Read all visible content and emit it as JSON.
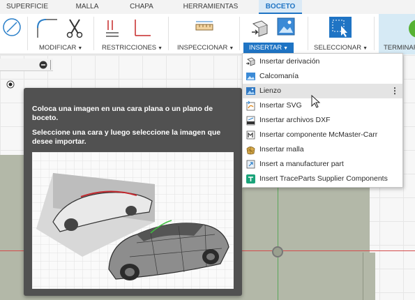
{
  "tabs": [
    {
      "label": "SUPERFICIE"
    },
    {
      "label": "MALLA"
    },
    {
      "label": "CHAPA"
    },
    {
      "label": "HERRAMIENTAS"
    },
    {
      "label": "BOCETO"
    }
  ],
  "ribbon": {
    "groups": [
      {
        "label": "MODIFICAR"
      },
      {
        "label": "RESTRICCIONES"
      },
      {
        "label": "INSPECCIONAR"
      },
      {
        "label": "INSERTAR"
      },
      {
        "label": "SELECCIONAR"
      },
      {
        "label": "TERMINAR"
      }
    ]
  },
  "insert_menu": {
    "items": [
      {
        "label": "Insertar derivación",
        "icon": "derive-icon"
      },
      {
        "label": "Calcomanía",
        "icon": "decal-icon"
      },
      {
        "label": "Lienzo",
        "icon": "canvas-icon"
      },
      {
        "label": "Insertar SVG",
        "icon": "svg-icon"
      },
      {
        "label": "Insertar archivos DXF",
        "icon": "dxf-icon"
      },
      {
        "label": "Insertar componente McMaster-Carr",
        "icon": "mcmaster-icon"
      },
      {
        "label": "Insertar malla",
        "icon": "mesh-icon"
      },
      {
        "label": "Insert a manufacturer part",
        "icon": "manufacturer-part-icon"
      },
      {
        "label": "Insert TraceParts Supplier Components",
        "icon": "traceparts-icon"
      }
    ],
    "more_glyph": "⋮"
  },
  "tooltip": {
    "line1": "Coloca una imagen en una cara plana o un plano de boceto.",
    "line2": "Seleccione una cara y luego seleccione la imagen que desee importar."
  },
  "colors": {
    "accent": "#1f74c4",
    "finish_green": "#56b233",
    "sketch_plane": "#b3b8a8"
  }
}
